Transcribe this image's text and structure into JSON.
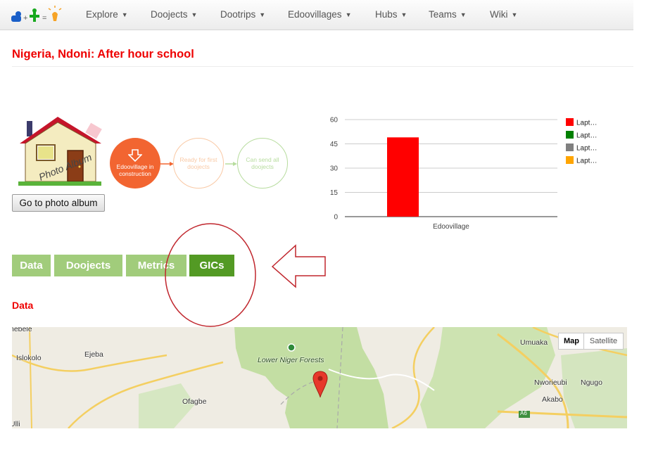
{
  "nav": {
    "items": [
      {
        "label": "Explore"
      },
      {
        "label": "Doojects"
      },
      {
        "label": "Dootrips"
      },
      {
        "label": "Edoovillages"
      },
      {
        "label": "Hubs"
      },
      {
        "label": "Teams"
      },
      {
        "label": "Wiki"
      }
    ]
  },
  "page": {
    "title": "Nigeria, Ndoni: After hour school"
  },
  "album": {
    "overlay_text": "Photo Album",
    "button_label": "Go to photo album"
  },
  "progress": {
    "steps": [
      {
        "label": "Edoovillage in construction",
        "state": "active",
        "color": "#f26531"
      },
      {
        "label": "Ready for first doojects",
        "state": "pending",
        "color": "#f9c9a5"
      },
      {
        "label": "Can send all doojects",
        "state": "pending",
        "color": "#b7dc9e"
      }
    ]
  },
  "chart_data": {
    "type": "bar",
    "categories": [
      "Edoovillage"
    ],
    "series": [
      {
        "name": "Lapt…",
        "color": "#ff0000",
        "values": [
          49
        ]
      },
      {
        "name": "Lapt…",
        "color": "#008000",
        "values": [
          0
        ]
      },
      {
        "name": "Lapt…",
        "color": "#808080",
        "values": [
          0
        ]
      },
      {
        "name": "Lapt…",
        "color": "#ffa500",
        "values": [
          0
        ]
      }
    ],
    "ylim": [
      0,
      60
    ],
    "yticks": [
      0,
      15,
      30,
      45,
      60
    ],
    "grid": true,
    "legend": "right"
  },
  "tabs": [
    {
      "label": "Data",
      "active": false
    },
    {
      "label": "Doojects",
      "active": false
    },
    {
      "label": "Metrics",
      "active": false
    },
    {
      "label": "GICs",
      "active": true
    }
  ],
  "section": {
    "title": "Data"
  },
  "map": {
    "labels": [
      "nebele",
      "Islokolo",
      "Ejeba",
      "Lower Niger Forests",
      "Ofagbe",
      "Umuaka",
      "Nworieubi",
      "Ngugo",
      "Akabo",
      "A6",
      "Ulli"
    ],
    "controls": {
      "map": "Map",
      "satellite": "Satellite"
    }
  },
  "icons": [
    "logo-icon",
    "arrow-down-icon",
    "map-marker-icon",
    "forest-marker-icon"
  ]
}
